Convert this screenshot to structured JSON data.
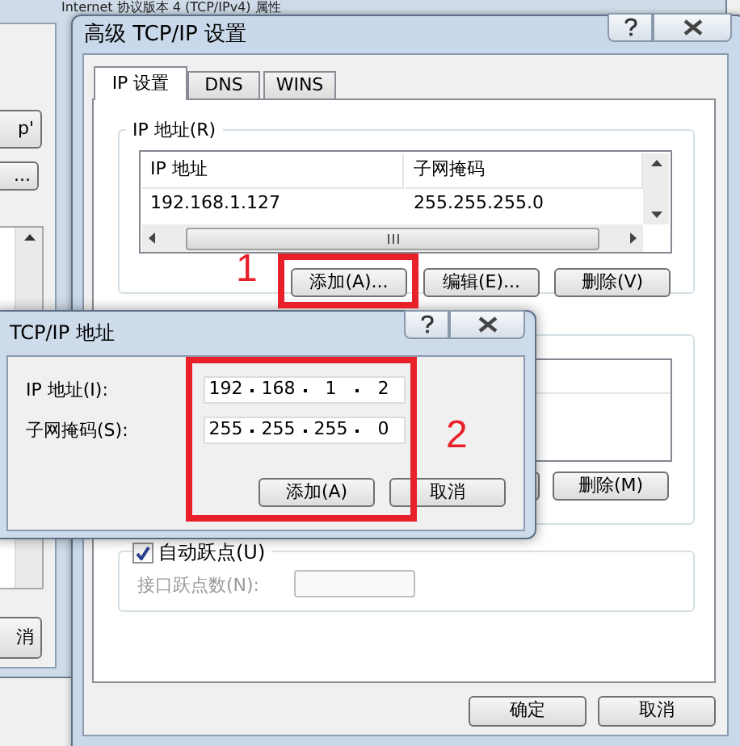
{
  "background_window": {
    "title": "Internet 协议版本 4 (TCP/IPv4) 属性",
    "buttons": [
      "p'",
      "..."
    ],
    "cancel_button": "消"
  },
  "advanced_dialog": {
    "title": "高级 TCP/IP 设置",
    "tabs": [
      {
        "label": "IP 设置",
        "selected": true
      },
      {
        "label": "DNS",
        "selected": false
      },
      {
        "label": "WINS",
        "selected": false
      }
    ],
    "ip_group": {
      "title": "IP 地址(R)",
      "columns": [
        "IP 地址",
        "子网掩码"
      ],
      "rows": [
        [
          "192.168.1.127",
          "255.255.255.0"
        ]
      ],
      "buttons": [
        "添加(A)...",
        "编辑(E)...",
        "删除(V)"
      ]
    },
    "gateway_group": {
      "buttons": [
        "删除(M)"
      ]
    },
    "metric": {
      "label": "自动跃点(U)",
      "checked": true,
      "interface_metric_label": "接口跃点数(N):"
    },
    "buttons": [
      "确定",
      "取消"
    ]
  },
  "address_dialog": {
    "title": "TCP/IP 地址",
    "fields": [
      {
        "label": "IP 地址(I):",
        "octets": [
          "192",
          "168",
          "1",
          "2"
        ]
      },
      {
        "label": "子网掩码(S):",
        "octets": [
          "255",
          "255",
          "255",
          "0"
        ]
      }
    ],
    "buttons": [
      "添加(A)",
      "取消"
    ]
  },
  "annotations": [
    {
      "label": "1",
      "color": "#e8202a"
    },
    {
      "label": "2",
      "color": "#e8202a"
    }
  ]
}
